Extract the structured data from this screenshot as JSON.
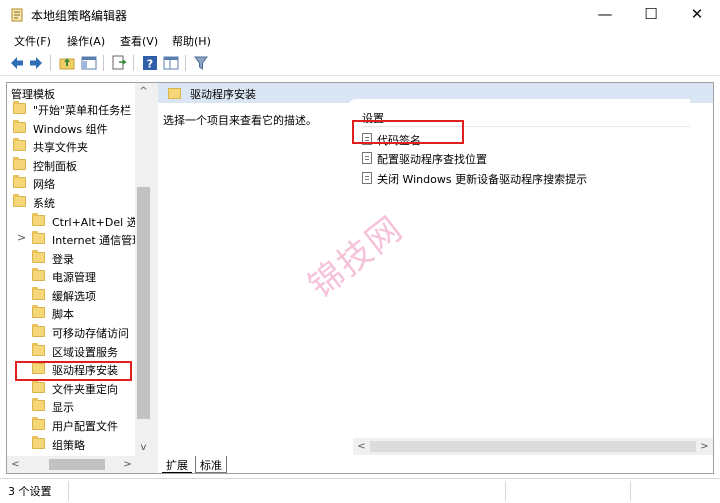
{
  "window": {
    "title": "本地组策略编辑器",
    "min_glyph": "—",
    "max_glyph": "☐",
    "close_glyph": "✕"
  },
  "menu": [
    "文件(F)",
    "操作(A)",
    "查看(V)",
    "帮助(H)"
  ],
  "toolbar": {
    "buttons": [
      "back-arrow-icon",
      "forward-arrow-icon",
      "up-folder-icon",
      "show-hide-tree-icon",
      "export-list-icon",
      "help-icon",
      "extended-view-icon",
      "filter-icon"
    ]
  },
  "tree": {
    "root": "管理模板",
    "scroll_up": "^",
    "scroll_down": "v",
    "scroll_left": "<",
    "scroll_right": ">",
    "items": [
      {
        "label": "\"开始\"菜单和任务栏",
        "level": 0
      },
      {
        "label": "Windows 组件",
        "level": 0
      },
      {
        "label": "共享文件夹",
        "level": 0
      },
      {
        "label": "控制面板",
        "level": 0
      },
      {
        "label": "网络",
        "level": 0
      },
      {
        "label": "系统",
        "level": 0
      },
      {
        "label": "Ctrl+Alt+Del 选项",
        "level": 1
      },
      {
        "label": "Internet 通信管理",
        "level": 1,
        "expander": ">"
      },
      {
        "label": "登录",
        "level": 1
      },
      {
        "label": "电源管理",
        "level": 1
      },
      {
        "label": "缓解选项",
        "level": 1
      },
      {
        "label": "脚本",
        "level": 1
      },
      {
        "label": "可移动存储访问",
        "level": 1
      },
      {
        "label": "区域设置服务",
        "level": 1
      },
      {
        "label": "驱动程序安装",
        "level": 1,
        "selected": true
      },
      {
        "label": "文件夹重定向",
        "level": 1
      },
      {
        "label": "显示",
        "level": 1
      },
      {
        "label": "用户配置文件",
        "level": 1
      },
      {
        "label": "组策略",
        "level": 1
      }
    ]
  },
  "right_pane": {
    "header": "驱动程序安装",
    "description": "选择一个项目来查看它的描述。",
    "list_header": "设置",
    "settings": [
      "代码签名",
      "配置驱动程序查找位置",
      "关闭 Windows 更新设备驱动程序搜索提示"
    ],
    "scroll_left": "<",
    "scroll_right": ">"
  },
  "tabs": {
    "expanded": "扩展",
    "standard": "标准"
  },
  "status": {
    "text": "3 个设置"
  },
  "watermark": "锦技网",
  "colors": {
    "highlight_border": "#e02020",
    "header_bg": "#dbe6f4"
  }
}
